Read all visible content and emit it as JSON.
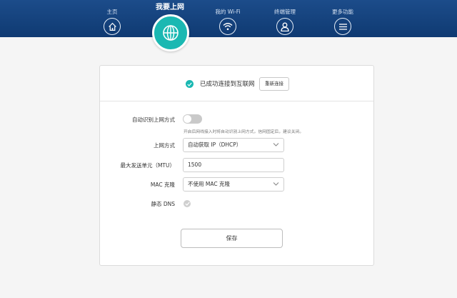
{
  "nav": {
    "items": [
      {
        "label": "主页",
        "icon": "home-icon"
      },
      {
        "label": "我要上网",
        "icon": "globe-icon",
        "active": true
      },
      {
        "label": "我的 Wi-Fi",
        "icon": "wifi-icon"
      },
      {
        "label": "终端管理",
        "icon": "user-icon"
      },
      {
        "label": "更多功能",
        "icon": "menu-icon"
      }
    ]
  },
  "status": {
    "text": "已成功连接到互联网",
    "reconnect_label": "重新连接"
  },
  "form": {
    "auto_detect": {
      "label": "自动识别上网方式",
      "enabled": false,
      "hint": "开启后网线接入时将自动识别上网方式，信网固定后，建议关闭。"
    },
    "mode": {
      "label": "上网方式",
      "value": "自动获取 IP（DHCP）"
    },
    "mtu": {
      "label": "最大发送单元（MTU）",
      "value": "1500"
    },
    "mac_clone": {
      "label": "MAC 克隆",
      "value": "不使用 MAC 克隆"
    },
    "static_dns": {
      "label": "静态 DNS",
      "checked": true
    }
  },
  "save_label": "保存",
  "colors": {
    "nav_bg": "#1c4c8a",
    "accent": "#1ab8b2"
  }
}
